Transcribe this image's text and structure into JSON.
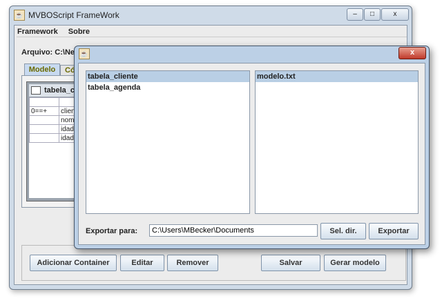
{
  "main_window": {
    "title": "MVBOScript FrameWork",
    "minimize": "–",
    "maximize": "□",
    "close": "x",
    "menu": [
      "Framework",
      "Sobre"
    ],
    "file_label": "Arquivo: C:\\NetB",
    "tabs": [
      "Modelo",
      "Có"
    ],
    "inner_frame": {
      "title": "tabela_cl",
      "rows": [
        [
          "0==+",
          "clien"
        ],
        [
          "",
          "nom"
        ],
        [
          "",
          "idad"
        ],
        [
          "",
          "idad"
        ]
      ]
    },
    "buttons": {
      "add": "Adicionar Container",
      "edit": "Editar",
      "remove": "Remover",
      "save": "Salvar",
      "generate": "Gerar modelo"
    }
  },
  "dialog": {
    "close": "x",
    "tables": [
      "tabela_cliente",
      "tabela_agenda"
    ],
    "files": [
      "modelo.txt"
    ],
    "export_label": "Exportar para:",
    "export_path": "C:\\Users\\MBecker\\Documents",
    "select_dir": "Sel. dir.",
    "export": "Exportar"
  }
}
